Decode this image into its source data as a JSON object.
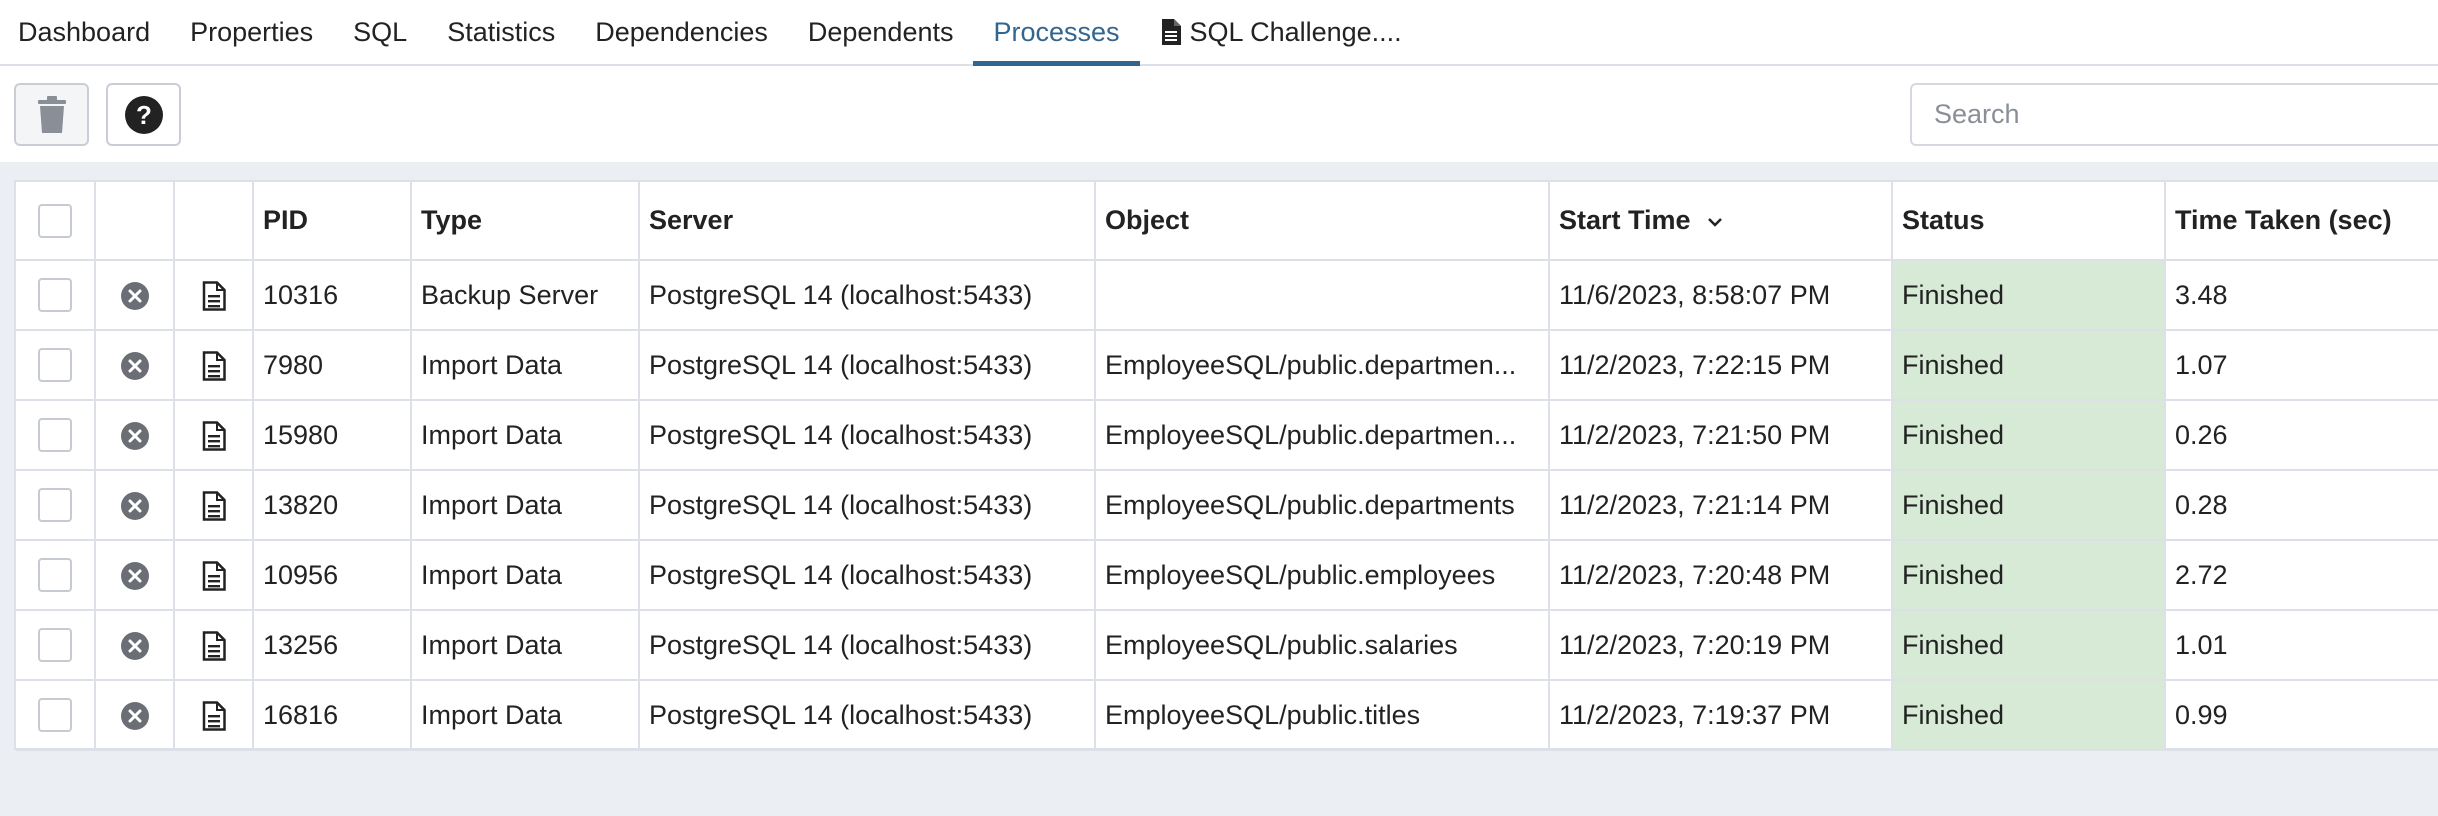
{
  "tabs": [
    {
      "label": "Dashboard",
      "active": false
    },
    {
      "label": "Properties",
      "active": false
    },
    {
      "label": "SQL",
      "active": false
    },
    {
      "label": "Statistics",
      "active": false
    },
    {
      "label": "Dependencies",
      "active": false
    },
    {
      "label": "Dependents",
      "active": false
    },
    {
      "label": "Processes",
      "active": true
    },
    {
      "label": "SQL Challenge....",
      "active": false,
      "icon": "file-icon"
    }
  ],
  "toolbar": {
    "delete_icon": "trash-icon",
    "help_icon": "help-circle-icon",
    "search_placeholder": "Search",
    "search_value": ""
  },
  "grid": {
    "columns": [
      "",
      "",
      "",
      "PID",
      "Type",
      "Server",
      "Object",
      "Start Time",
      "Status",
      "Time Taken (sec)"
    ],
    "sort": {
      "column": "Start Time",
      "direction": "descending"
    },
    "row_icons": {
      "stop": "stop-circle-icon",
      "logs": "document-icon"
    },
    "status_color": "#d6ead5",
    "rows": [
      {
        "pid": "10316",
        "type": "Backup Server",
        "server": "PostgreSQL 14 (localhost:5433)",
        "object": "",
        "start_time": "11/6/2023, 8:58:07 PM",
        "status": "Finished",
        "time_taken": "3.48"
      },
      {
        "pid": "7980",
        "type": "Import Data",
        "server": "PostgreSQL 14 (localhost:5433)",
        "object": "EmployeeSQL/public.departmen...",
        "start_time": "11/2/2023, 7:22:15 PM",
        "status": "Finished",
        "time_taken": "1.07"
      },
      {
        "pid": "15980",
        "type": "Import Data",
        "server": "PostgreSQL 14 (localhost:5433)",
        "object": "EmployeeSQL/public.departmen...",
        "start_time": "11/2/2023, 7:21:50 PM",
        "status": "Finished",
        "time_taken": "0.26"
      },
      {
        "pid": "13820",
        "type": "Import Data",
        "server": "PostgreSQL 14 (localhost:5433)",
        "object": "EmployeeSQL/public.departments",
        "start_time": "11/2/2023, 7:21:14 PM",
        "status": "Finished",
        "time_taken": "0.28"
      },
      {
        "pid": "10956",
        "type": "Import Data",
        "server": "PostgreSQL 14 (localhost:5433)",
        "object": "EmployeeSQL/public.employees",
        "start_time": "11/2/2023, 7:20:48 PM",
        "status": "Finished",
        "time_taken": "2.72"
      },
      {
        "pid": "13256",
        "type": "Import Data",
        "server": "PostgreSQL 14 (localhost:5433)",
        "object": "EmployeeSQL/public.salaries",
        "start_time": "11/2/2023, 7:20:19 PM",
        "status": "Finished",
        "time_taken": "1.01"
      },
      {
        "pid": "16816",
        "type": "Import Data",
        "server": "PostgreSQL 14 (localhost:5433)",
        "object": "EmployeeSQL/public.titles",
        "start_time": "11/2/2023, 7:19:37 PM",
        "status": "Finished",
        "time_taken": "0.99"
      }
    ]
  }
}
